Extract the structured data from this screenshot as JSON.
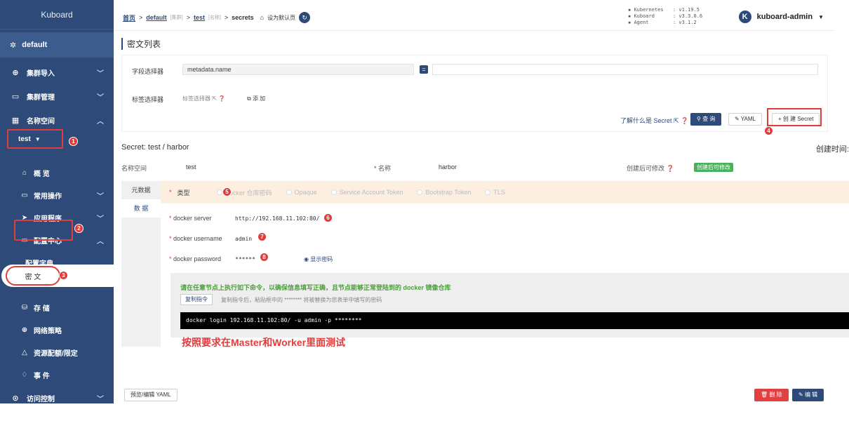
{
  "app": {
    "title": "Kuboard"
  },
  "colors": {
    "sidebar": "#2d4a78",
    "accent": "#2d4a78",
    "annotation": "#e03c3c",
    "danger": "#e04040",
    "success": "#48b05e"
  },
  "sidebar": {
    "cluster": "default",
    "items": [
      {
        "label": "集群导入",
        "icon": "cluster-icon"
      },
      {
        "label": "集群管理",
        "icon": "monitor-icon"
      },
      {
        "label": "名称空间",
        "icon": "grid-icon"
      }
    ],
    "namespace": "test",
    "namespace_children": [
      {
        "label": "概 览",
        "icon": "home-icon"
      },
      {
        "label": "常用操作",
        "icon": "folder-icon"
      },
      {
        "label": "应用程序",
        "icon": "send-icon"
      },
      {
        "label": "配置中心",
        "icon": "folder-icon"
      }
    ],
    "config_children": [
      "配置字典",
      "密 文"
    ],
    "lower_items": [
      {
        "label": "存 储",
        "icon": "database-icon"
      },
      {
        "label": "网络策略",
        "icon": "network-icon"
      },
      {
        "label": "资源配额/限定",
        "icon": "quota-icon"
      },
      {
        "label": "事 件",
        "icon": "bell-icon"
      },
      {
        "label": "访问控制",
        "icon": "lock-icon"
      }
    ],
    "badges": {
      "b1": "1",
      "b2": "2",
      "b3": "3"
    }
  },
  "header": {
    "crumb_home": "首页",
    "crumb_default": "default",
    "crumb_default_tag": "[集群]",
    "crumb_test": "test",
    "crumb_test_tag": "[名称]",
    "crumb_current": "secrets",
    "set_default": "设为默认页",
    "versions": [
      {
        "k": "Kubernetes",
        "v": ": v1.19.5"
      },
      {
        "k": "Kuboard",
        "v": ": v3.3.0.6"
      },
      {
        "k": "Agent",
        "v": ": v3.1.2"
      }
    ],
    "user": "kuboard-admin",
    "avatar": "K"
  },
  "list": {
    "title": "密文列表",
    "field_selector_label": "字段选择器",
    "field_selector_value": "metadata.name",
    "eq": "=",
    "label_selector_label": "标签选择器",
    "label_selector_hint": "标签选择器",
    "add": "添 加",
    "learn": "了解什么是 Secret",
    "query": "查 询",
    "yaml": "YAML",
    "create": "+ 创 建 Secret",
    "badge4": "4"
  },
  "detail": {
    "title": "Secret: test / harbor",
    "created_at_label": "创建时间:",
    "ns_label": "名称空间",
    "ns_value": "test",
    "name_label": "* 名称",
    "name_value": "harbor",
    "editable_label": "创建后可修改",
    "editable_tag": "创建后可修改",
    "tabs": [
      "元数据",
      "数 据"
    ],
    "type_label": "类型",
    "badge5": "5",
    "types": [
      "Docker 仓库密码",
      "Opaque",
      "Service Account Token",
      "Bootstrap Token",
      "TLS"
    ],
    "server_label": "docker server",
    "server_value": "http://192.168.11.102:80/",
    "badge6": "6",
    "username_label": "docker username",
    "username_value": "admin",
    "badge7": "7",
    "password_label": "docker password",
    "password_value": "******",
    "badge8": "8",
    "show_password": "显示密码",
    "cmd_notice": "请在任意节点上执行如下命令，以确保信息填写正确，且节点能够正常登陆到的 docker 镜像仓库",
    "copy_cmd": "复制指令",
    "copy_hint": "复制指令后，粘贴框中的 ******** 将被替换为您表单中填写的密码",
    "command": "docker login 192.168.11.102:80/ -u admin -p ********",
    "annotation": "按照要求在Master和Worker里面测试",
    "preview_yaml": "预览/编辑 YAML",
    "delete": "删 除",
    "edit": "编 辑"
  }
}
